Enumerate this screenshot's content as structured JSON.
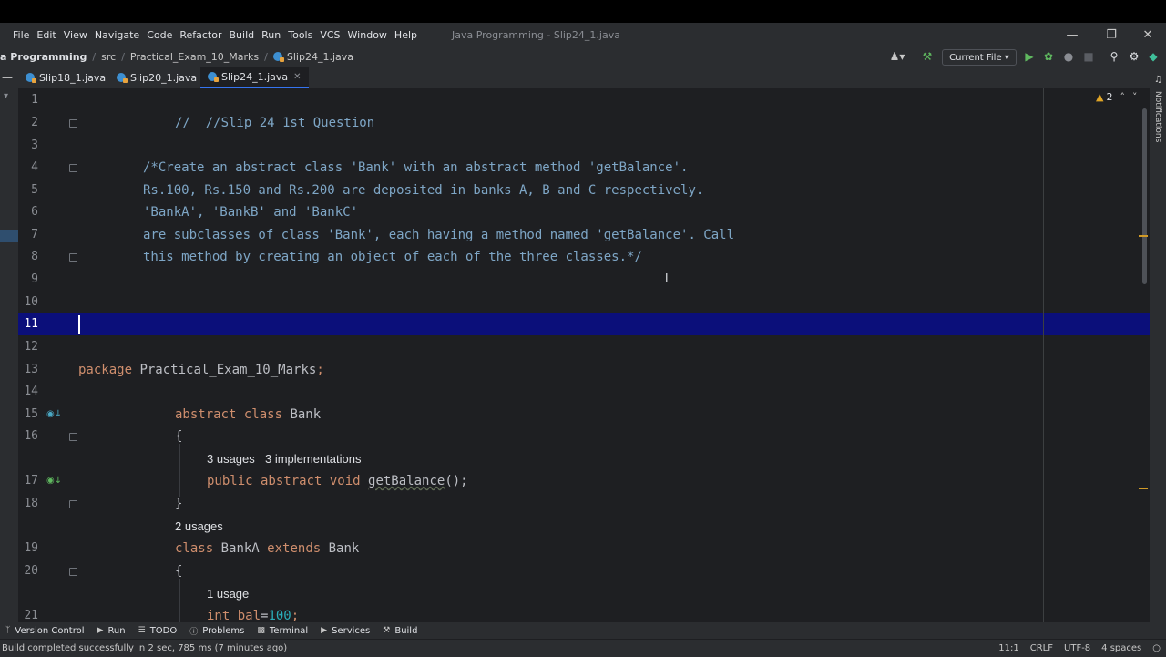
{
  "menu": [
    "File",
    "Edit",
    "View",
    "Navigate",
    "Code",
    "Refactor",
    "Build",
    "Run",
    "Tools",
    "VCS",
    "Window",
    "Help"
  ],
  "window_title": "Java Programming - Slip24_1.java",
  "breadcrumb": {
    "project": "a Programming",
    "src": "src",
    "package": "Practical_Exam_10_Marks",
    "file": "Slip24_1.java"
  },
  "run_config": "Current File",
  "tabs": [
    {
      "label": "Slip18_1.java"
    },
    {
      "label": "Slip20_1.java"
    },
    {
      "label": "Slip24_1.java",
      "active": true
    }
  ],
  "warnings_count": "2",
  "notifications_label": "Notifications",
  "lines": {
    "l1": {
      "n": "1"
    },
    "l2": {
      "n": "2",
      "text": "//  //Slip 24 1st Question"
    },
    "l3": {
      "n": "3"
    },
    "l4": {
      "n": "4",
      "text": "/*Create an abstract class 'Bank' with an abstract method 'getBalance'."
    },
    "l5": {
      "n": "5",
      "text": "Rs.100, Rs.150 and Rs.200 are deposited in banks A, B and C respectively."
    },
    "l6": {
      "n": "6",
      "text": "'BankA', 'BankB' and 'BankC'"
    },
    "l7": {
      "n": "7",
      "text": "are subclasses of class 'Bank', each having a method named 'getBalance'. Call"
    },
    "l8": {
      "n": "8",
      "text": "this method by creating an object of each of the three classes.*/"
    },
    "l9": {
      "n": "9"
    },
    "l10": {
      "n": "10"
    },
    "l11": {
      "n": "11"
    },
    "l12": {
      "n": "12"
    },
    "l13": {
      "n": "13",
      "kw": "package",
      "name": " Practical_Exam_10_Marks",
      "semi": ";"
    },
    "l14": {
      "n": "14"
    },
    "l15": {
      "n": "15",
      "kw": "abstract class",
      "name": " Bank"
    },
    "l16": {
      "n": "16",
      "text": "{"
    },
    "h17": {
      "usages": "3 usages",
      "impls": "3 implementations"
    },
    "l17": {
      "n": "17",
      "kw": "public abstract void",
      "fn": "getBalance",
      "rest": "();"
    },
    "l18": {
      "n": "18",
      "text": "}"
    },
    "h19": {
      "usages": "2 usages"
    },
    "l19": {
      "n": "19",
      "kw1": "class",
      "name": " BankA ",
      "kw2": "extends",
      "name2": " Bank"
    },
    "l20": {
      "n": "20",
      "text": "{"
    },
    "h21": {
      "usages": "1 usage"
    },
    "l21": {
      "n": "21",
      "kw": "int",
      "var": " bal",
      "eq": "=",
      "num": "100",
      "semi": ";"
    }
  },
  "tool_windows": [
    {
      "label": "Version Control",
      "icon": "branch-icon"
    },
    {
      "label": "Run",
      "icon": "play-icon"
    },
    {
      "label": "TODO",
      "icon": "list-icon"
    },
    {
      "label": "Problems",
      "icon": "info-icon"
    },
    {
      "label": "Terminal",
      "icon": "terminal-icon"
    },
    {
      "label": "Services",
      "icon": "services-icon"
    },
    {
      "label": "Build",
      "icon": "hammer-icon"
    }
  ],
  "status": {
    "message": "Build completed successfully in 2 sec, 785 ms (7 minutes ago)",
    "position": "11:1",
    "line_sep": "CRLF",
    "encoding": "UTF-8",
    "indent": "4 spaces"
  },
  "colors": {
    "caret_row": "#0b0f7a",
    "comment": "#7ea6c6",
    "keyword": "#cf8e6d",
    "number": "#2aacb8"
  }
}
